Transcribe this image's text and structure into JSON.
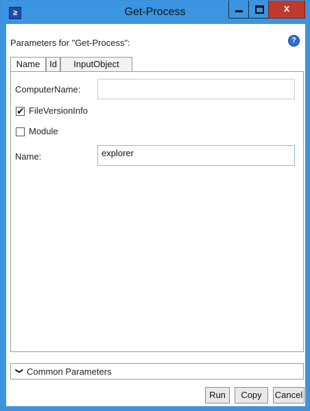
{
  "window": {
    "title": "Get-Process",
    "minimize_glyph": "",
    "maximize_glyph": "",
    "close_glyph": "x"
  },
  "header": {
    "params_label": "Parameters for \"Get-Process\":",
    "help_glyph": "?"
  },
  "tabs": [
    {
      "label": "Name",
      "active": true
    },
    {
      "label": "Id",
      "active": false
    },
    {
      "label": "InputObject",
      "active": false
    }
  ],
  "form": {
    "computername_label": "ComputerName:",
    "computername_value": "",
    "fileversioninfo_label": "FileVersionInfo",
    "fileversioninfo_checked": true,
    "module_label": "Module",
    "module_checked": false,
    "name_label": "Name:",
    "name_value": "explorer",
    "check_glyph": "✔"
  },
  "common": {
    "chevron": "❯",
    "label": "Common Parameters"
  },
  "buttons": {
    "run": "Run",
    "copy": "Copy",
    "cancel": "Cancel"
  },
  "colors": {
    "titlebar": "#3b95e0",
    "close_button": "#c0392b"
  }
}
